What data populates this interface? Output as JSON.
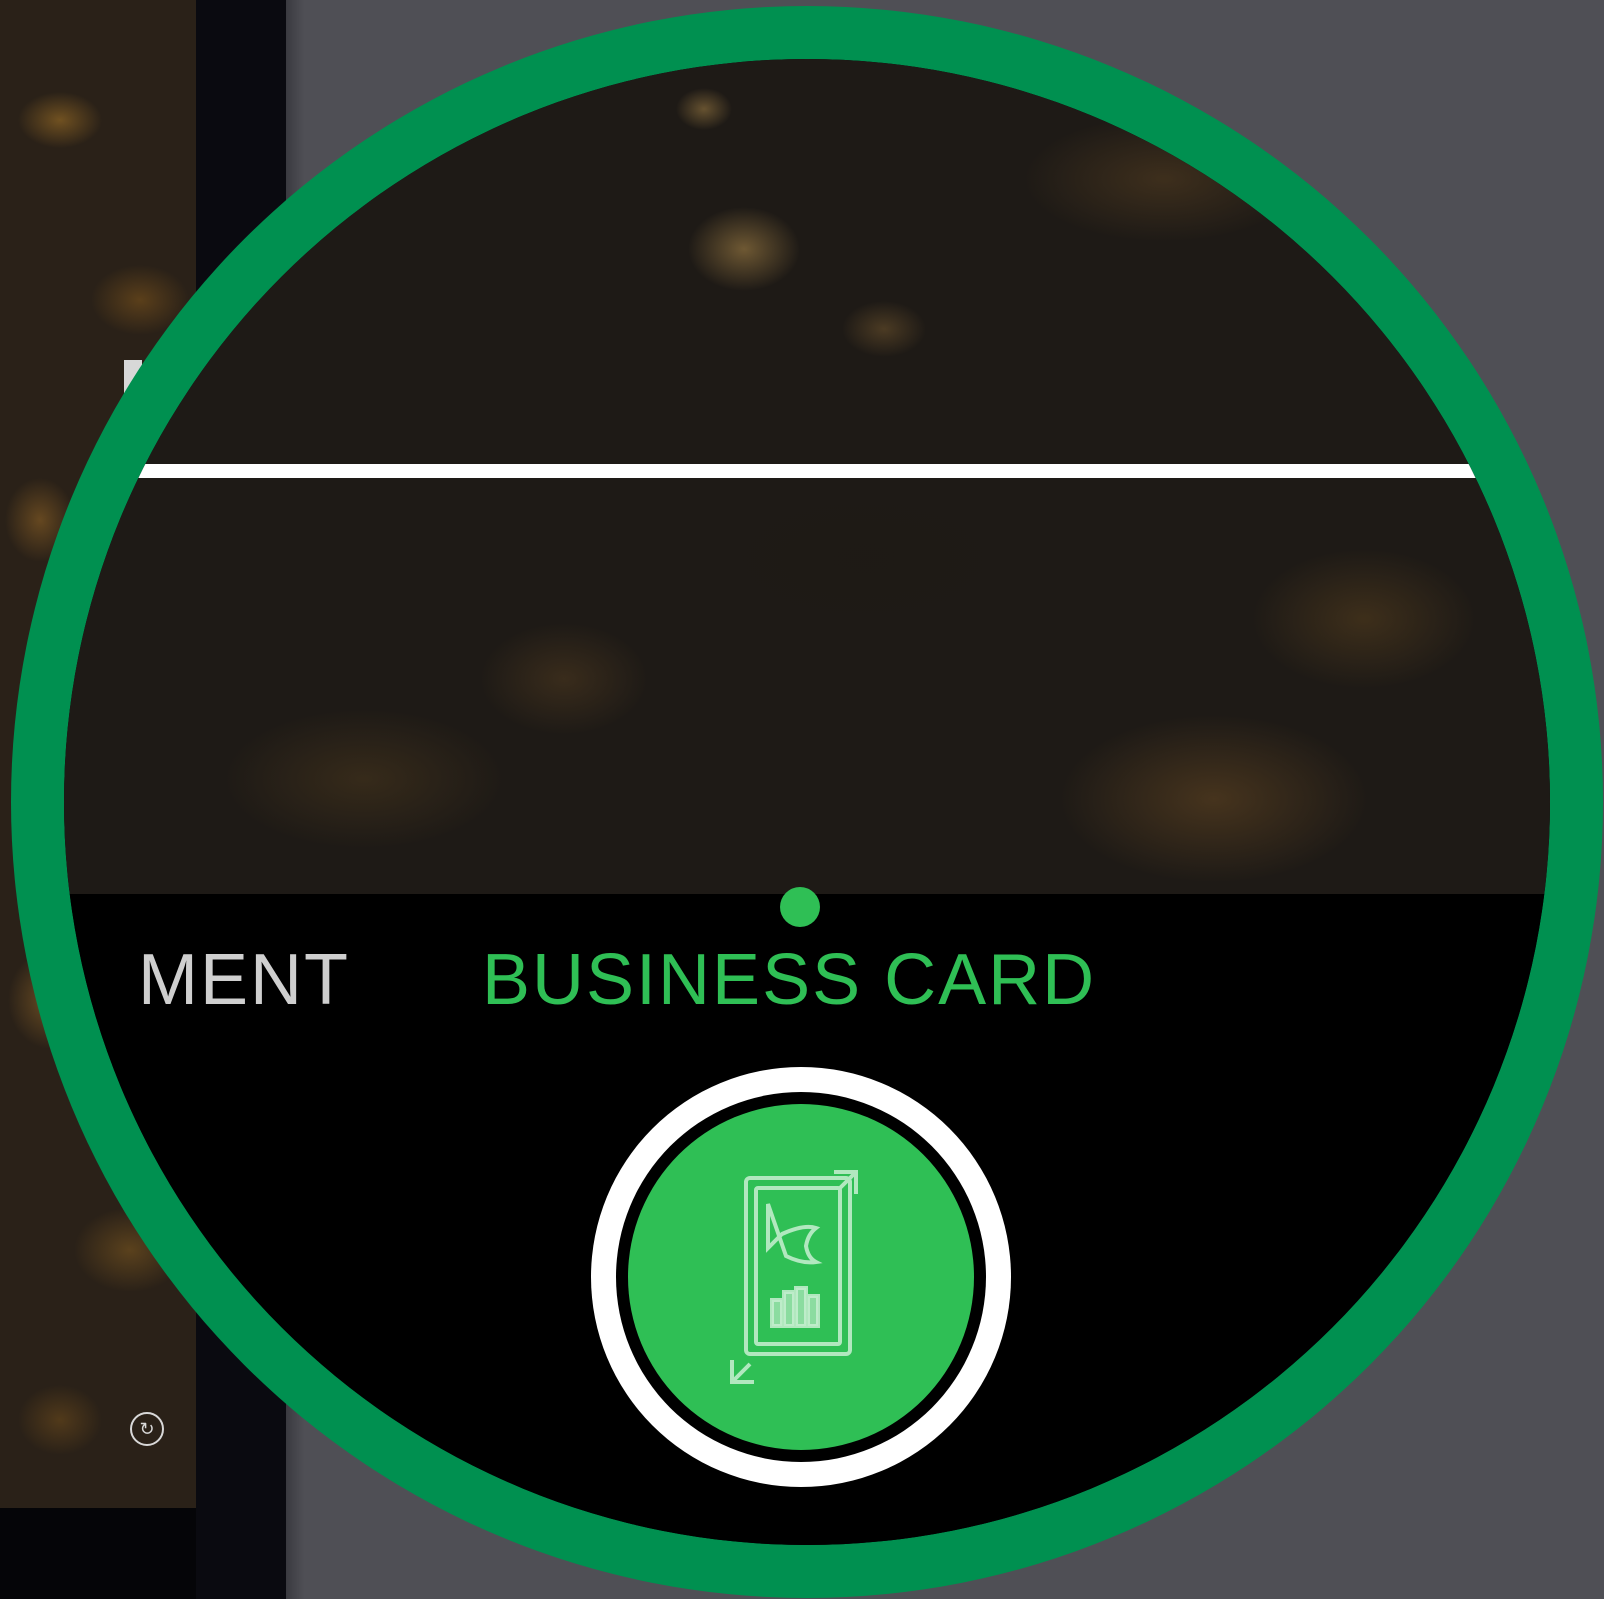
{
  "modes": {
    "previous_label": "MENT",
    "current_label": "BUSINESS CARD"
  },
  "colors": {
    "accent": "#2fbf55",
    "magnifier_ring": "#009050",
    "inactive_text": "#cfcfcf"
  },
  "icons": {
    "shutter_icon": "business-card-scan-icon",
    "small_icon": "rotate-icon"
  }
}
